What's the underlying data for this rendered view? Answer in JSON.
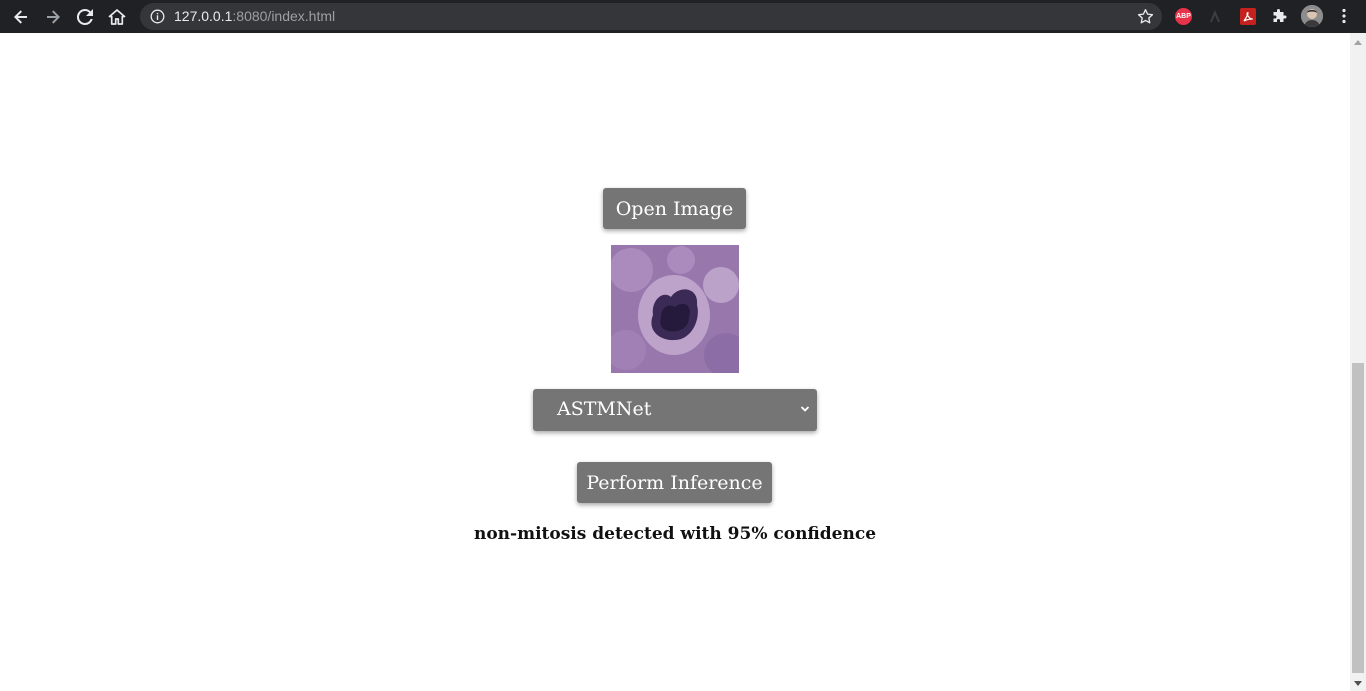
{
  "browser": {
    "url_host": "127.0.0.1",
    "url_rest": ":8080/index.html",
    "extensions": {
      "abp_label": "ABP"
    }
  },
  "page": {
    "open_button_label": "Open Image",
    "model_select": {
      "selected": "ASTMNet",
      "options": [
        "ASTMNet"
      ]
    },
    "infer_button_label": "Perform Inference",
    "result_text": "non-mitosis detected with 95% confidence"
  },
  "colors": {
    "button_bg": "#757575",
    "toolbar_bg": "#202124",
    "omnibox_bg": "#35363a"
  }
}
